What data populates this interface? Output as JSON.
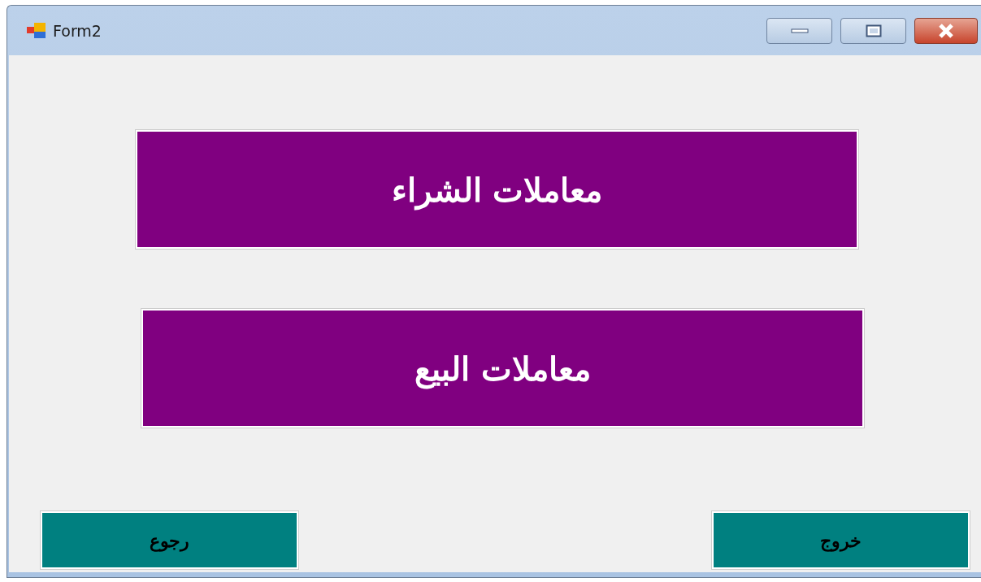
{
  "window": {
    "title": "Form2"
  },
  "main_buttons": [
    {
      "label": "معاملات الشراء"
    },
    {
      "label": "معاملات البيع"
    }
  ],
  "bottom_buttons": [
    {
      "label": "خروج"
    },
    {
      "label": "رجوع"
    }
  ]
}
